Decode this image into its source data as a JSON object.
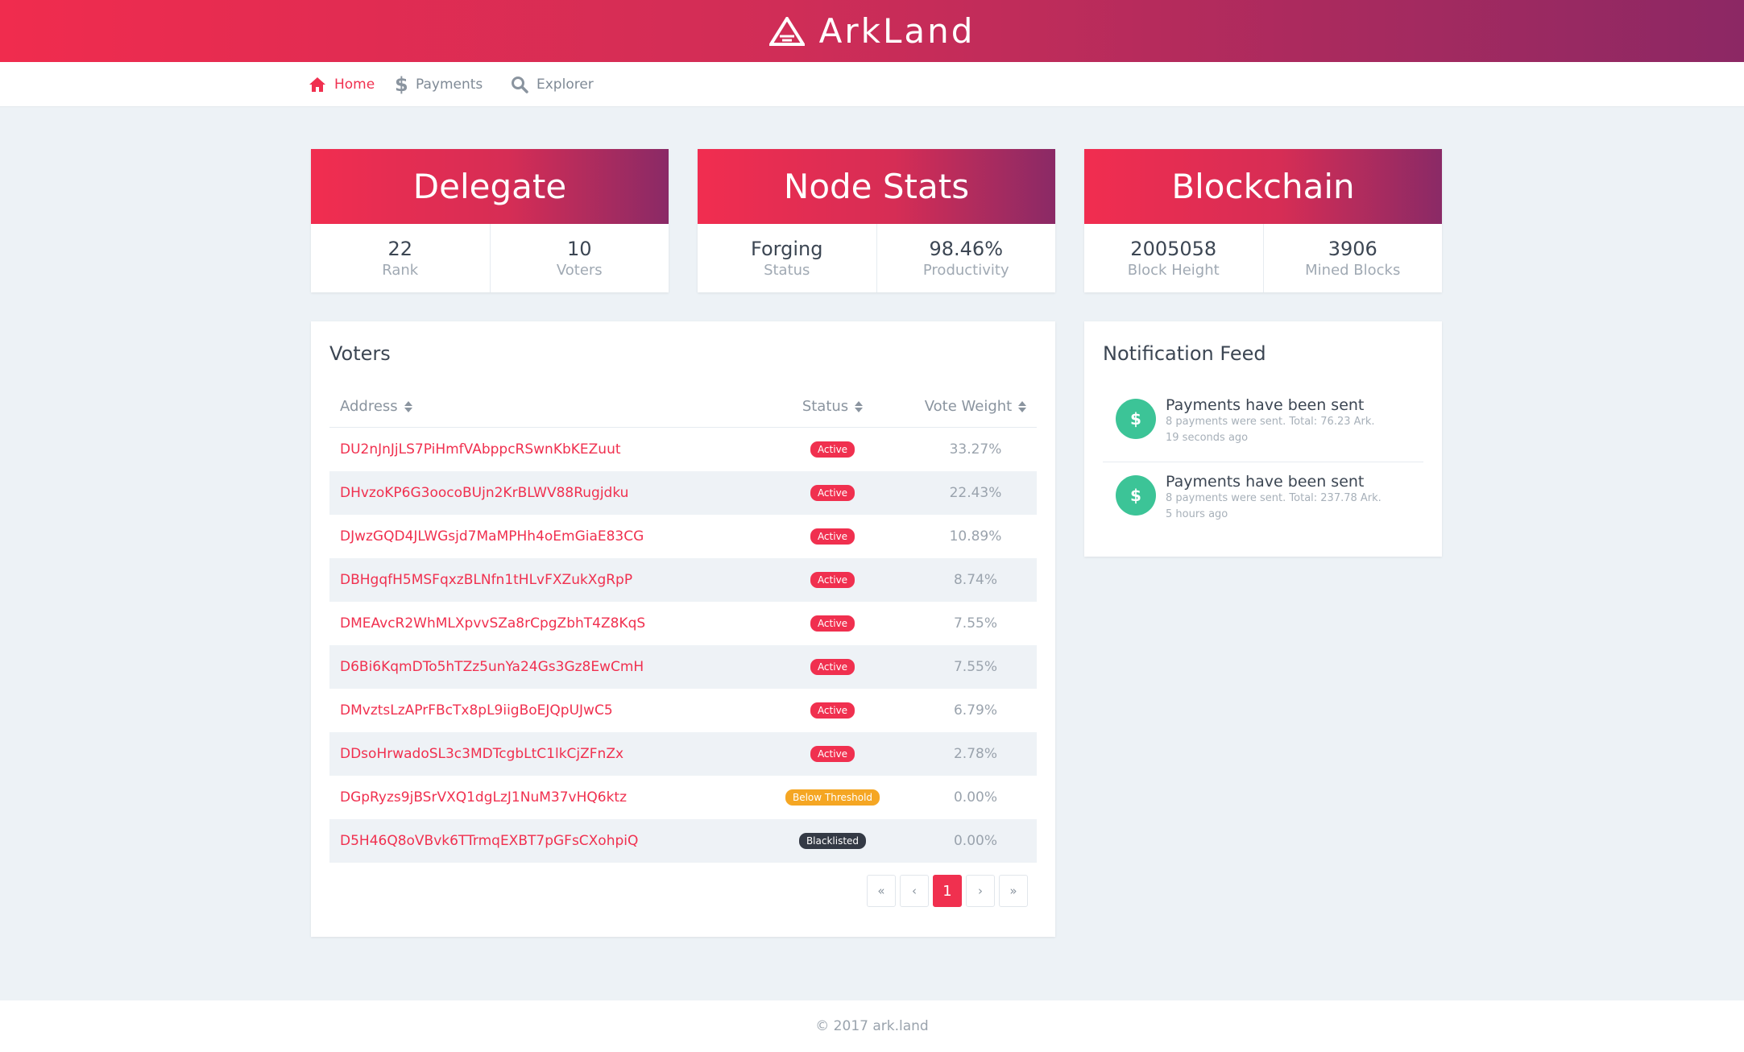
{
  "app": {
    "name": "ArkLand"
  },
  "nav": [
    {
      "label": "Home",
      "icon": "home-icon",
      "active": true
    },
    {
      "label": "Payments",
      "icon": "dollar-icon",
      "active": false
    },
    {
      "label": "Explorer",
      "icon": "search-icon",
      "active": false
    }
  ],
  "cards": [
    {
      "title": "Delegate",
      "stats": [
        {
          "value": "22",
          "label": "Rank"
        },
        {
          "value": "10",
          "label": "Voters"
        }
      ]
    },
    {
      "title": "Node Stats",
      "stats": [
        {
          "value": "Forging",
          "label": "Status"
        },
        {
          "value": "98.46%",
          "label": "Productivity"
        }
      ]
    },
    {
      "title": "Blockchain",
      "stats": [
        {
          "value": "2005058",
          "label": "Block Height"
        },
        {
          "value": "3906",
          "label": "Mined Blocks"
        }
      ]
    }
  ],
  "voters": {
    "title": "Voters",
    "columns": {
      "address": "Address",
      "status": "Status",
      "weight": "Vote Weight"
    },
    "rows": [
      {
        "address": "DU2nJnJjLS7PiHmfVAbppcRSwnKbKEZuut",
        "status": "Active",
        "weight": "33.27%"
      },
      {
        "address": "DHvzoKP6G3oocoBUjn2KrBLWV88Rugjdku",
        "status": "Active",
        "weight": "22.43%"
      },
      {
        "address": "DJwzGQD4JLWGsjd7MaMPHh4oEmGiaE83CG",
        "status": "Active",
        "weight": "10.89%"
      },
      {
        "address": "DBHgqfH5MSFqxzBLNfn1tHLvFXZukXgRpP",
        "status": "Active",
        "weight": "8.74%"
      },
      {
        "address": "DMEAvcR2WhMLXpvvSZa8rCpgZbhT4Z8KqS",
        "status": "Active",
        "weight": "7.55%"
      },
      {
        "address": "D6Bi6KqmDTo5hTZz5unYa24Gs3Gz8EwCmH",
        "status": "Active",
        "weight": "7.55%"
      },
      {
        "address": "DMvztsLzAPrFBcTx8pL9iigBoEJQpUJwC5",
        "status": "Active",
        "weight": "6.79%"
      },
      {
        "address": "DDsoHrwadoSL3c3MDTcgbLtC1lkCjZFnZx",
        "status": "Active",
        "weight": "2.78%"
      },
      {
        "address": "DGpRyzs9jBSrVXQ1dgLzJ1NuM37vHQ6ktz",
        "status": "Below Threshold",
        "weight": "0.00%"
      },
      {
        "address": "D5H46Q8oVBvk6TTrmqEXBT7pGFsCXohpiQ",
        "status": "Blacklisted",
        "weight": "0.00%"
      }
    ],
    "pagination": {
      "first": "«",
      "prev": "‹",
      "current": "1",
      "next": "›",
      "last": "»"
    }
  },
  "feed": {
    "title": "Notification Feed",
    "items": [
      {
        "icon": "dollar-icon",
        "title": "Payments have been sent",
        "desc": "8 payments were sent. Total: 76.23 Ark.",
        "time": "19 seconds ago"
      },
      {
        "icon": "dollar-icon",
        "title": "Payments have been sent",
        "desc": "8 payments were sent. Total: 237.78 Ark.",
        "time": "5 hours ago"
      }
    ]
  },
  "footer": {
    "text": "© 2017 ark.land"
  },
  "colors": {
    "accent": "#f0304f",
    "gradient_end": "#8c2864",
    "success": "#3cc497",
    "warning": "#f5a623",
    "dark": "#343a45"
  }
}
